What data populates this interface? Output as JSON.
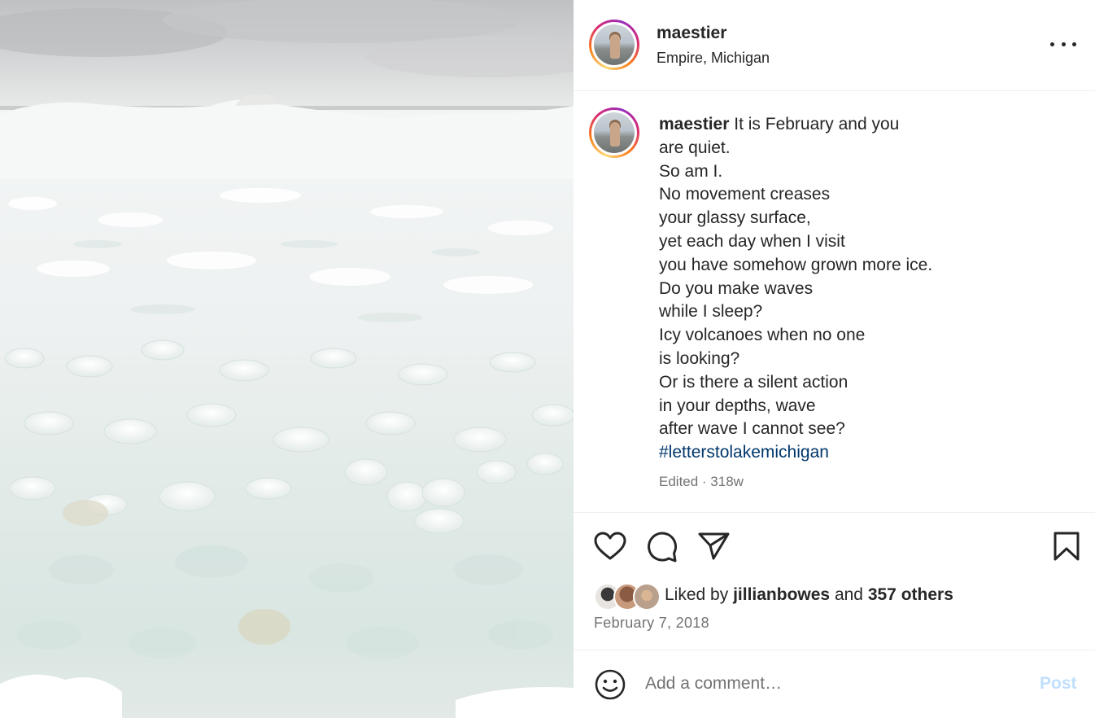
{
  "post": {
    "username": "maestier",
    "location": "Empire, Michigan",
    "caption_user": "maestier",
    "caption_lines": [
      "It is February and you",
      "are quiet.",
      "So am I.",
      "No movement creases",
      "your glassy surface,",
      "yet each day when I visit",
      "you have somehow grown more ice.",
      "Do you make waves",
      "while I sleep?",
      "Icy volcanoes when no one",
      "is looking?",
      "Or is there a silent action",
      "in your depths, wave",
      "after wave I cannot see?"
    ],
    "hashtag": "#letterstolakemichigan",
    "meta": "Edited · 318w",
    "liked_prefix": "Liked by",
    "liked_user": "jillianbowes",
    "liked_and": "and",
    "liked_others": "357 others",
    "date": "February 7, 2018"
  },
  "comment": {
    "placeholder": "Add a comment…",
    "post_label": "Post"
  },
  "icons": {
    "more": "more-options-icon",
    "like": "heart-icon",
    "comment": "comment-bubble-icon",
    "share": "paper-plane-icon",
    "save": "bookmark-icon",
    "emoji": "emoji-smile-icon"
  },
  "colors": {
    "text": "#262626",
    "secondary": "#737373",
    "link": "#00376b",
    "post_button_disabled": "#c0dffd",
    "divider": "#efefef"
  }
}
